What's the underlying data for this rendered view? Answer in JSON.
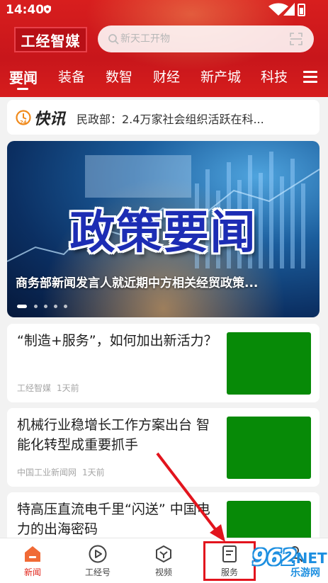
{
  "status_bar": {
    "time": "14:40"
  },
  "header": {
    "logo_text": "工经智媒",
    "search_placeholder": "新天工开物"
  },
  "tabs": [
    {
      "label": "要闻",
      "active": true
    },
    {
      "label": "装备",
      "active": false
    },
    {
      "label": "数智",
      "active": false
    },
    {
      "label": "财经",
      "active": false
    },
    {
      "label": "新产城",
      "active": false
    },
    {
      "label": "科技",
      "active": false
    }
  ],
  "flash_news": {
    "title": "快讯",
    "text": "民政部：2.4万家社会组织活跃在科..."
  },
  "banner": {
    "headline": "政策要闻",
    "caption": "商务部新闻发言人就近期中方相关经贸政策...",
    "slide_count": 5,
    "active_slide": 1
  },
  "articles": [
    {
      "title": "“制造+服务”，如何加出新活力？",
      "source": "工经智媒",
      "time": "1天前",
      "thumb_color": "#078a07"
    },
    {
      "title": "机械行业稳增长工作方案出台 智能化转型成重要抓手",
      "source": "中国工业新闻网",
      "time": "1天前",
      "thumb_color": "#078a07"
    },
    {
      "title": "特高压直流电千里“闪送” 中国电力的出海密码",
      "source": "",
      "time": "",
      "thumb_color": "#078a07"
    }
  ],
  "bottom_nav": [
    {
      "label": "新闻",
      "icon": "home-icon",
      "active": true
    },
    {
      "label": "工经号",
      "icon": "play-circle-icon",
      "active": false
    },
    {
      "label": "视频",
      "icon": "video-cube-icon",
      "active": false
    },
    {
      "label": "服务",
      "icon": "service-doc-icon",
      "active": false
    },
    {
      "label": "",
      "icon": "person-icon",
      "active": false
    }
  ],
  "watermark": {
    "number": "962",
    "net": ".NET",
    "cn": "乐游网"
  },
  "colors": {
    "brand_red": "#d81e1e",
    "active_nav": "#e1251b",
    "thumb_green": "#078a07",
    "annotation_red": "#e2141d"
  }
}
